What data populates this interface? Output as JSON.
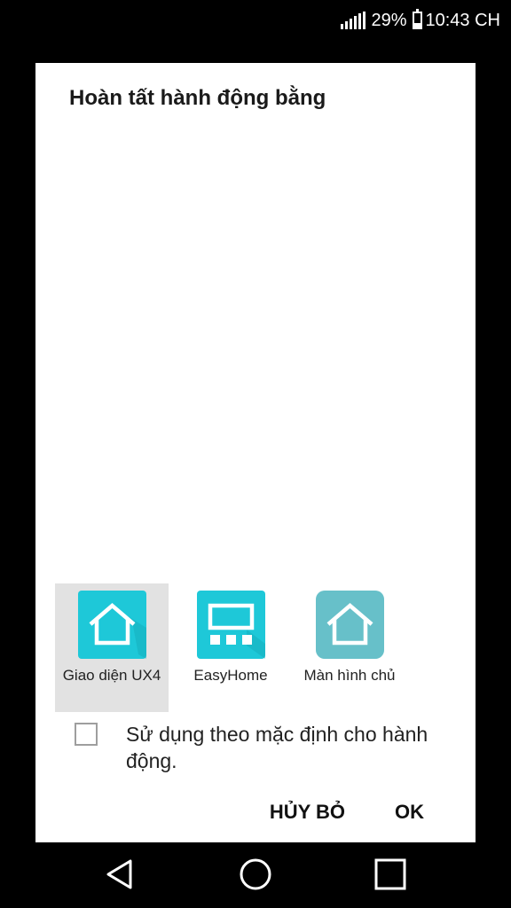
{
  "status_bar": {
    "battery_percent": "29%",
    "battery_level": 0.29,
    "time": "10:43 CH",
    "icons": [
      "signal-icon",
      "battery-icon"
    ]
  },
  "dialog": {
    "title": "Hoàn tất hành động bằng",
    "apps": [
      {
        "label": "Giao diện UX4",
        "icon": "home-icon",
        "selected": true,
        "color": "#1ec8d8"
      },
      {
        "label": "EasyHome",
        "icon": "easyhome-icon",
        "selected": false,
        "color": "#1ec8d8"
      },
      {
        "label": "Màn hình chủ",
        "icon": "home-outline-icon",
        "selected": false,
        "color": "#6ec7cf"
      }
    ],
    "checkbox": {
      "label": "Sử dụng theo mặc định cho hành động.",
      "checked": false
    },
    "cancel_label": "HỦY BỎ",
    "ok_label": "OK"
  },
  "nav_bar": {
    "buttons": [
      "back-icon",
      "home-circle-icon",
      "recents-icon"
    ]
  },
  "colors": {
    "background": "#000000",
    "dialog": "#ffffff",
    "selected_item": "#e2e2e2",
    "accent": "#1ec8d8"
  }
}
